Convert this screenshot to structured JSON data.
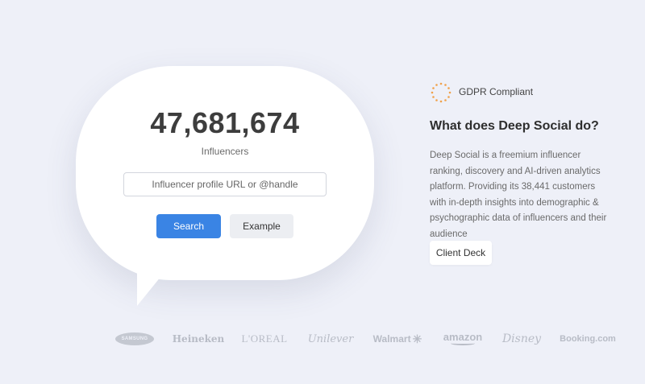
{
  "hero": {
    "count": "47,681,674",
    "count_label": "Influencers",
    "search_placeholder": "Influencer profile URL or @handle",
    "search_button": "Search",
    "example_button": "Example"
  },
  "about": {
    "gdpr_icon": "eu-stars-icon",
    "gdpr_label": "GDPR Compliant",
    "title": "What does Deep Social do?",
    "description": "Deep Social is a freemium influencer ranking, discovery and AI-driven analytics platform. Providing its 38,441 customers with in-depth insights into demographic & psychographic data of influencers and their audience",
    "deck_button": "Client Deck"
  },
  "logos": {
    "samsung": "SAMSUNG",
    "heineken": "Heineken",
    "loreal": "L'OREAL",
    "unilever": "Unilever",
    "walmart": "Walmart",
    "amazon": "amazon",
    "disney": "Disney",
    "booking": "Booking.com"
  },
  "colors": {
    "background": "#eef0f8",
    "primary": "#3a84e4",
    "gdpr_accent": "#f0a14a"
  }
}
